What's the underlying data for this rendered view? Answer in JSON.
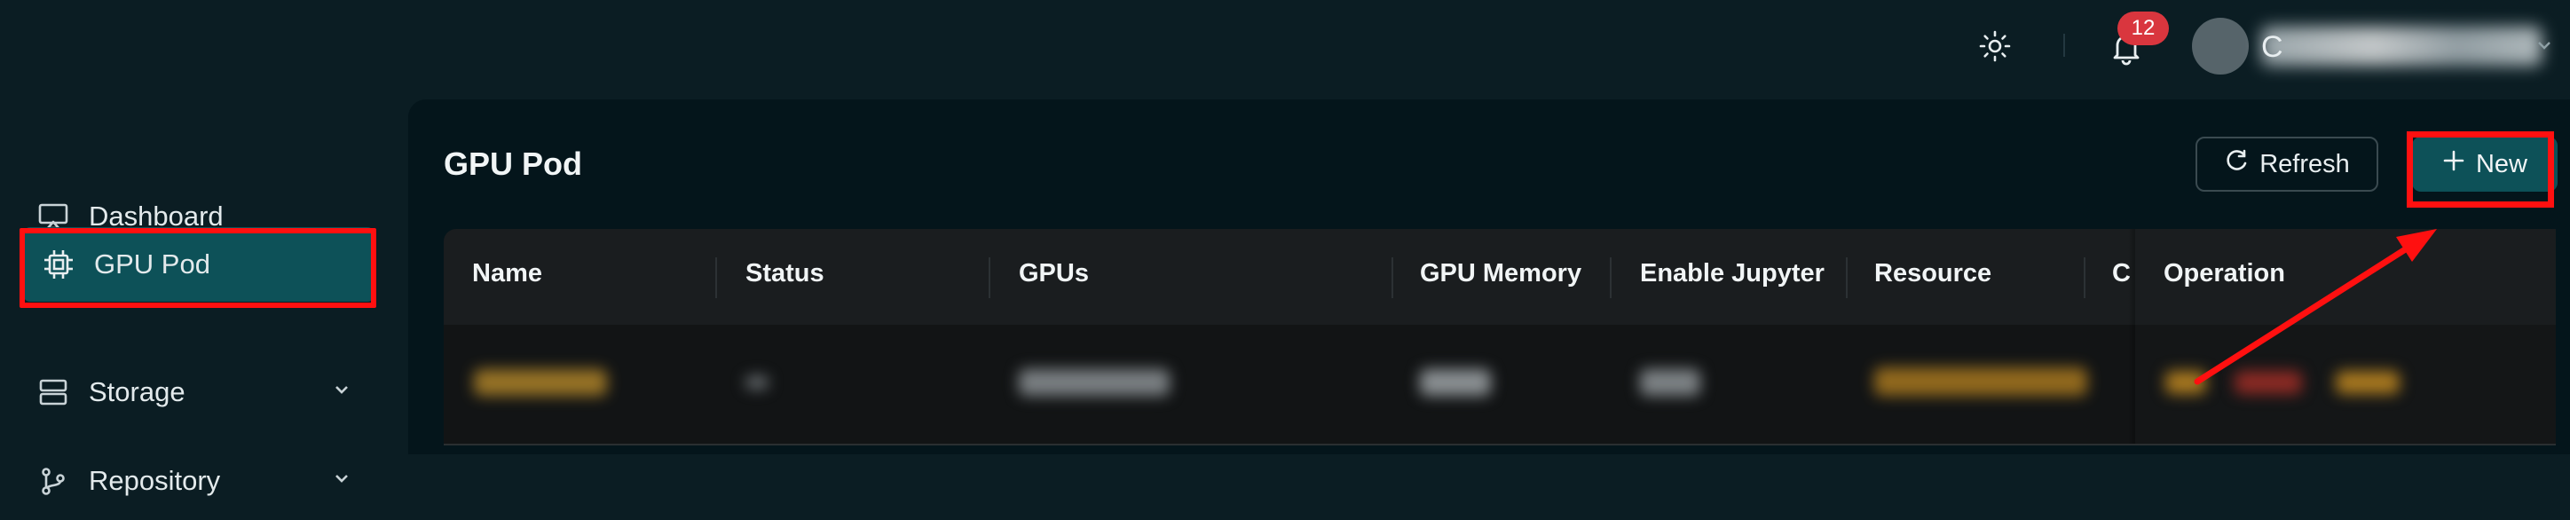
{
  "header": {
    "notification_count": "12",
    "user_initial": "C",
    "icons": {
      "theme": "sun-icon",
      "notifications": "bell-icon",
      "user_menu": "chevron-down-icon"
    }
  },
  "sidebar": {
    "items": [
      {
        "label": "Dashboard",
        "icon": "monitor-icon",
        "expandable": false
      },
      {
        "label": "GPU Pod",
        "icon": "chip-icon",
        "expandable": false,
        "active": true
      },
      {
        "label": "Storage",
        "icon": "server-icon",
        "expandable": true
      },
      {
        "label": "Repository",
        "icon": "branch-icon",
        "expandable": true
      }
    ]
  },
  "main": {
    "title": "GPU Pod",
    "refresh_label": "Refresh",
    "new_label": "New"
  },
  "table": {
    "columns": [
      "Name",
      "Status",
      "GPUs",
      "GPU Memory",
      "Enable Jupyter",
      "Resource",
      "C",
      "Operation"
    ]
  },
  "colors": {
    "background": "#0b1d23",
    "panel": "#04151b",
    "accent": "#0d5158",
    "annotation": "#ff1010",
    "badge": "#d9363e"
  }
}
